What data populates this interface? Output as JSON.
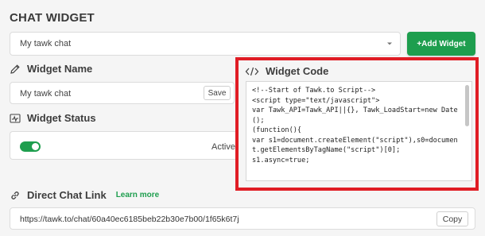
{
  "section": {
    "title": "CHAT WIDGET"
  },
  "widget_select": {
    "value": "My tawk chat"
  },
  "add_widget": {
    "label": "+Add Widget"
  },
  "widget_name": {
    "label": "Widget Name",
    "value": "My tawk chat",
    "save_label": "Save"
  },
  "widget_status": {
    "label": "Widget Status",
    "state_label": "Active",
    "enabled": true
  },
  "widget_code": {
    "label": "Widget Code",
    "code": "<!--Start of Tawk.to Script-->\n<script type=\"text/javascript\">\nvar Tawk_API=Tawk_API||{}, Tawk_LoadStart=new Date();\n(function(){\nvar s1=document.createElement(\"script\"),s0=document.getElementsByTagName(\"script\")[0];\ns1.async=true;"
  },
  "direct_chat_link": {
    "label": "Direct Chat Link",
    "learn_more": "Learn more",
    "url": "https://tawk.to/chat/60a40ec6185beb22b30e7b00/1f65k6t7j",
    "copy_label": "Copy"
  },
  "colors": {
    "accent": "#1e9e4e",
    "highlight": "#e01d25"
  }
}
